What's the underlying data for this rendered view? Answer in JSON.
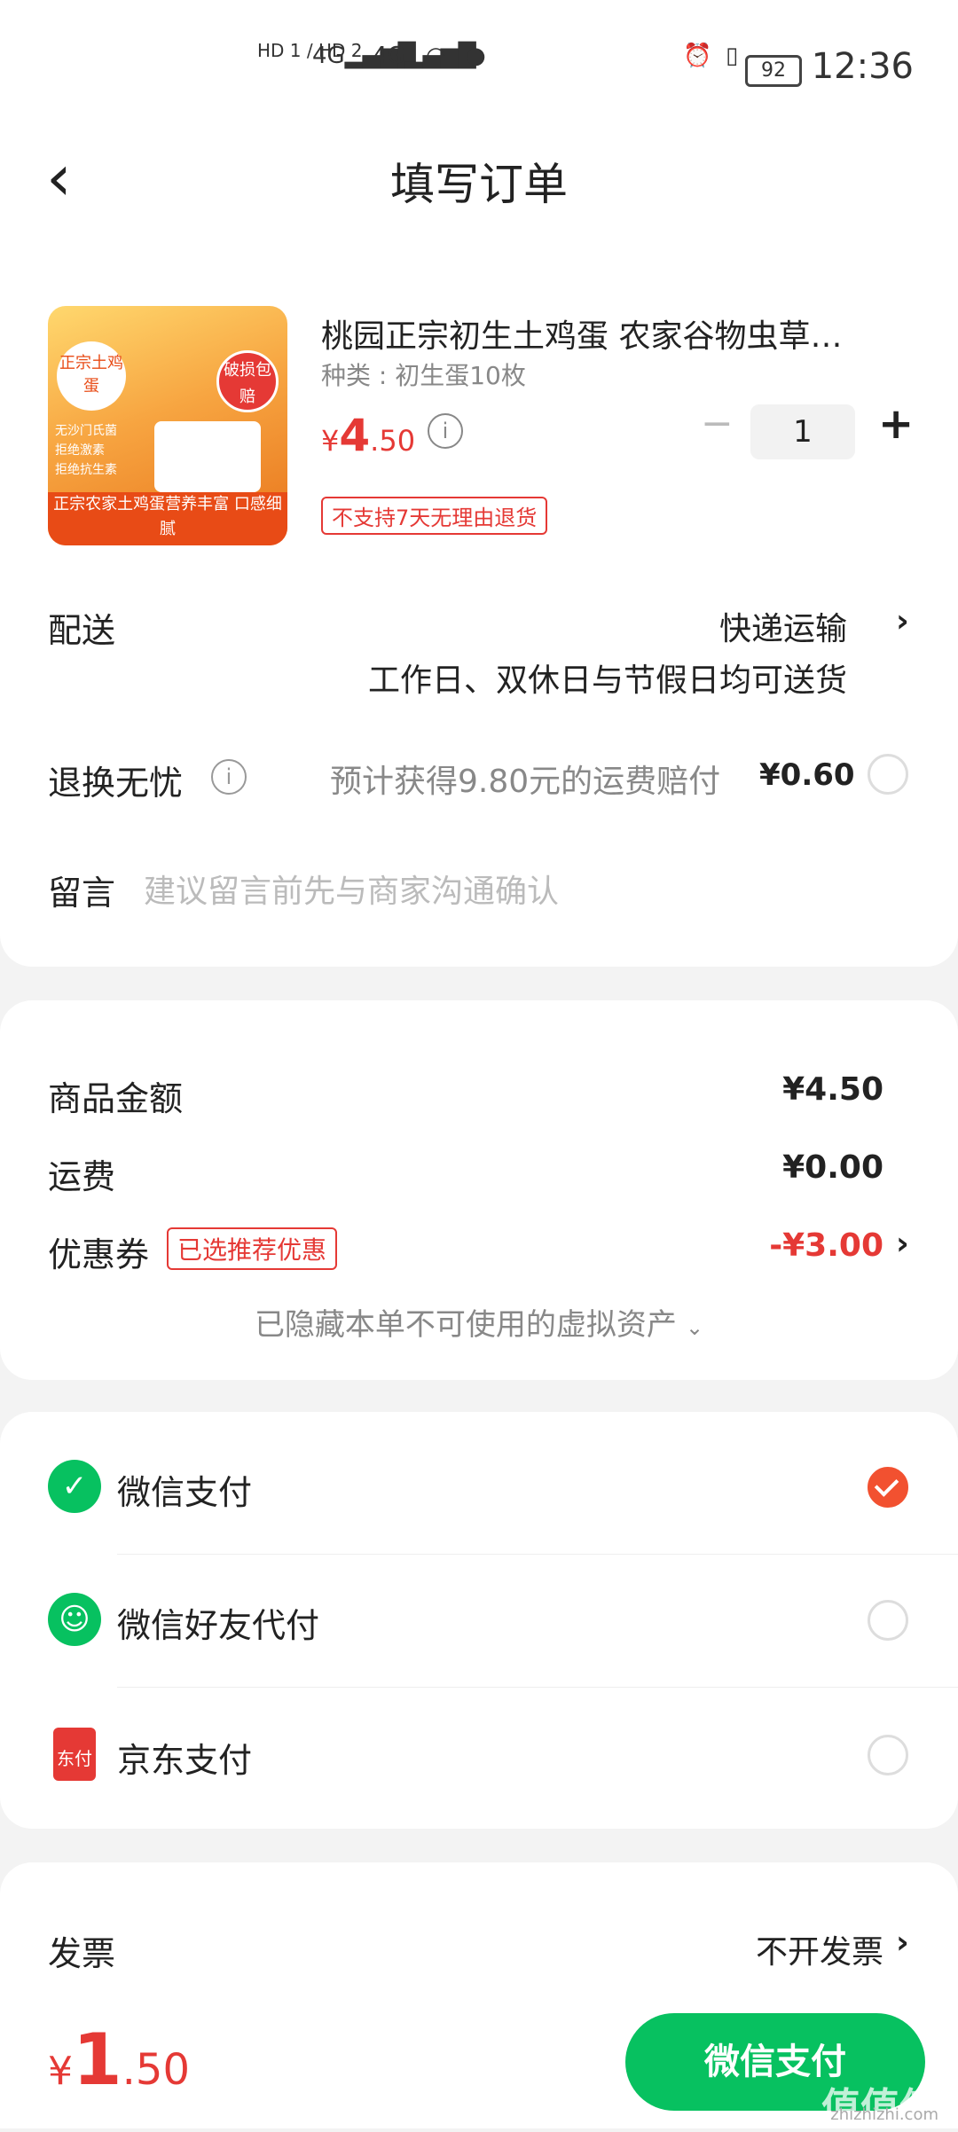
{
  "status_bar": {
    "time": "12:36",
    "battery": "92",
    "network_left": "HD 1 / HD 2",
    "net1": "4G",
    "net2": "4G"
  },
  "header": {
    "title": "填写订单",
    "back_icon": "chevron-left-icon"
  },
  "product": {
    "title": "桃园正宗初生土鸡蛋 农家谷物虫草…",
    "variant": "种类 : 初生蛋10枚",
    "price_symbol": "¥",
    "price_int": "4",
    "price_dec": ".50",
    "quantity": "1",
    "minus": "−",
    "plus": "+",
    "return_tag": "不支持7天无理由退货",
    "image_text": {
      "label_top": "正宗土鸡蛋",
      "badge": "破损包赔",
      "features": [
        "无沙门氏菌",
        "拒绝激素",
        "拒绝抗生素"
      ],
      "band": "正宗农家土鸡蛋营养丰富 口感细腻"
    }
  },
  "delivery": {
    "label": "配送",
    "method": "快递运输",
    "note": "工作日、双休日与节假日均可送货"
  },
  "return_insurance": {
    "label": "退换无忧",
    "desc": "预计获得9.80元的运费赔付",
    "price": "¥0.60"
  },
  "message": {
    "label": "留言",
    "placeholder": "建议留言前先与商家沟通确认"
  },
  "summary": {
    "goods_label": "商品金额",
    "goods_value": "¥4.50",
    "shipping_label": "运费",
    "shipping_value": "¥0.00",
    "coupon_label": "优惠券",
    "coupon_tag": "已选推荐优惠",
    "coupon_value": "-¥3.00",
    "hidden_assets": "已隐藏本单不可使用的虚拟资产"
  },
  "payment": {
    "options": [
      {
        "label": "微信支付",
        "selected": true
      },
      {
        "label": "微信好友代付",
        "selected": false
      },
      {
        "label": "京东支付",
        "selected": false
      }
    ],
    "jd_icon_text": "东付"
  },
  "invoice": {
    "label": "发票",
    "value": "不开发票"
  },
  "footer": {
    "total_symbol": "¥",
    "total_int": "1",
    "total_dec": ".50",
    "pay_button": "微信支付",
    "watermark": "值值值",
    "watermark_url": "zhizhizhi.com"
  },
  "colors": {
    "accent_red": "#e53935",
    "wechat_green": "#07c160",
    "check_orange": "#f25130"
  }
}
